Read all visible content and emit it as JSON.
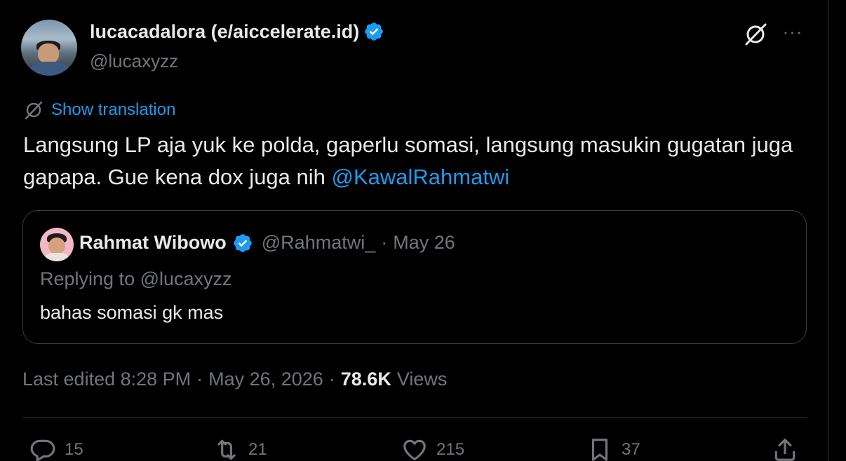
{
  "author": {
    "display_name": "lucacadalora (e/aiccelerate.id)",
    "handle": "@lucaxyzz",
    "verified": true
  },
  "icons": {
    "verified": "verified-badge-icon",
    "grok": "grok-icon",
    "more": "more-options-icon",
    "translate": "translate-icon",
    "reply": "reply-icon",
    "retweet": "retweet-icon",
    "like": "heart-icon",
    "bookmark": "bookmark-icon",
    "share": "share-icon"
  },
  "more_label": "···",
  "translate_label": "Show translation",
  "tweet": {
    "text": "Langsung LP aja yuk ke polda, gaperlu somasi, langsung masukin gugatan juga gapapa. Gue kena dox juga nih ",
    "mention": "@KawalRahmatwi"
  },
  "quote": {
    "display_name": "Rahmat Wibowo",
    "handle": "@Rahmatwi_",
    "dot": "·",
    "date": "May 26",
    "replying_prefix": "Replying to ",
    "replying_handle": "@lucaxyzz",
    "text": "bahas somasi gk mas"
  },
  "meta": {
    "edited": "Last edited 8:28 PM",
    "sep": "·",
    "date": "May 26, 2026",
    "views_count": "78.6K",
    "views_label": "Views"
  },
  "actions": {
    "replies": "15",
    "retweets": "21",
    "likes": "215",
    "bookmarks": "37"
  },
  "colors": {
    "background": "#000000",
    "text": "#e7e9ea",
    "secondary": "#71767b",
    "accent": "#1d9bf0",
    "border": "#2f3336"
  }
}
